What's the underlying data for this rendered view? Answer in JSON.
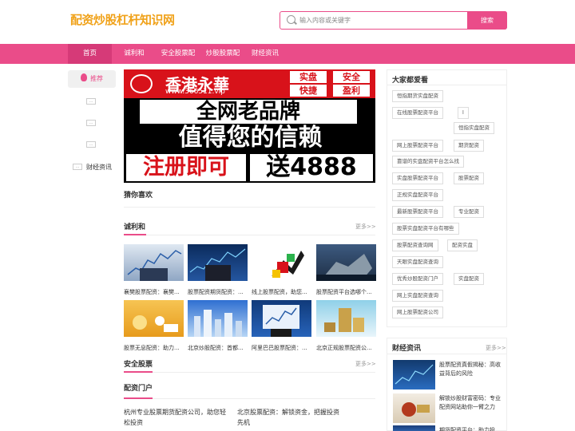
{
  "header": {
    "logo": "配资炒股杠杆知识网",
    "search_placeholder": "输入内容或关键字",
    "search_button": "搜索"
  },
  "nav": {
    "items": [
      "首页",
      "诚利和",
      "安全股票配",
      "炒股股票配",
      "财经资讯"
    ]
  },
  "sidebar": {
    "recommend": "推荐",
    "dots": [
      "...",
      "...",
      "..."
    ],
    "finance_dot": "...",
    "finance": "财经资讯"
  },
  "banner": {
    "title": "香港永華",
    "url": "www.366511.vip",
    "tags": [
      "实盘",
      "安全",
      "快捷",
      "盈利"
    ],
    "line1": "全网老品牌",
    "line2": "值得您的信赖",
    "line3a": "注册即可",
    "line3b": "送4888"
  },
  "guess": {
    "title": "猜你喜欢"
  },
  "chenglihe": {
    "title": "诚利和",
    "more": "更多>>",
    "items": [
      "襄樊股票配资：襄樊...",
      "股票配资期货配资：...",
      "线上股票配资，助您...",
      "股票配资平台选哪个...",
      "股票无息配资：助力...",
      "北京炒股配资：首都...",
      "阿里巴巴股票配资：...",
      "北京正规股票配资公..."
    ]
  },
  "safe": {
    "title": "安全股票",
    "more": "更多>>"
  },
  "portal": {
    "title": "配资门户",
    "items": [
      "杭州专业股票期货配资公司，助您轻松投资",
      "北京股票配资：解锁资金，把握投资先机"
    ]
  },
  "popular": {
    "title": "大家都爱看",
    "tags": [
      "恒指期货实盘配资",
      "在线股票配资平台",
      "l",
      "恒指实盘配资",
      "网上股票配资平台",
      "期货配资",
      "靠谱的实盘配资平台怎么找",
      "实盘股票配资平台",
      "股票配资",
      "正规实盘配资平台",
      "最新股票配资平台",
      "专业配资",
      "股票实盘配资平台有哪些",
      "股票配资查询网",
      "配资实盘",
      "天眼实盘配资查询",
      "优秀炒股配资门户",
      "实盘配资",
      "网上实盘配资查询",
      "网上股票配资公司"
    ]
  },
  "finance": {
    "title": "财经资讯",
    "more": "更多>>",
    "items": [
      "股票配资真假揭秘：高收益背后的风险",
      "解锁炒股财富密码：专业配资网站助你一臂之力",
      "期货配资平台：助力投资..."
    ]
  }
}
